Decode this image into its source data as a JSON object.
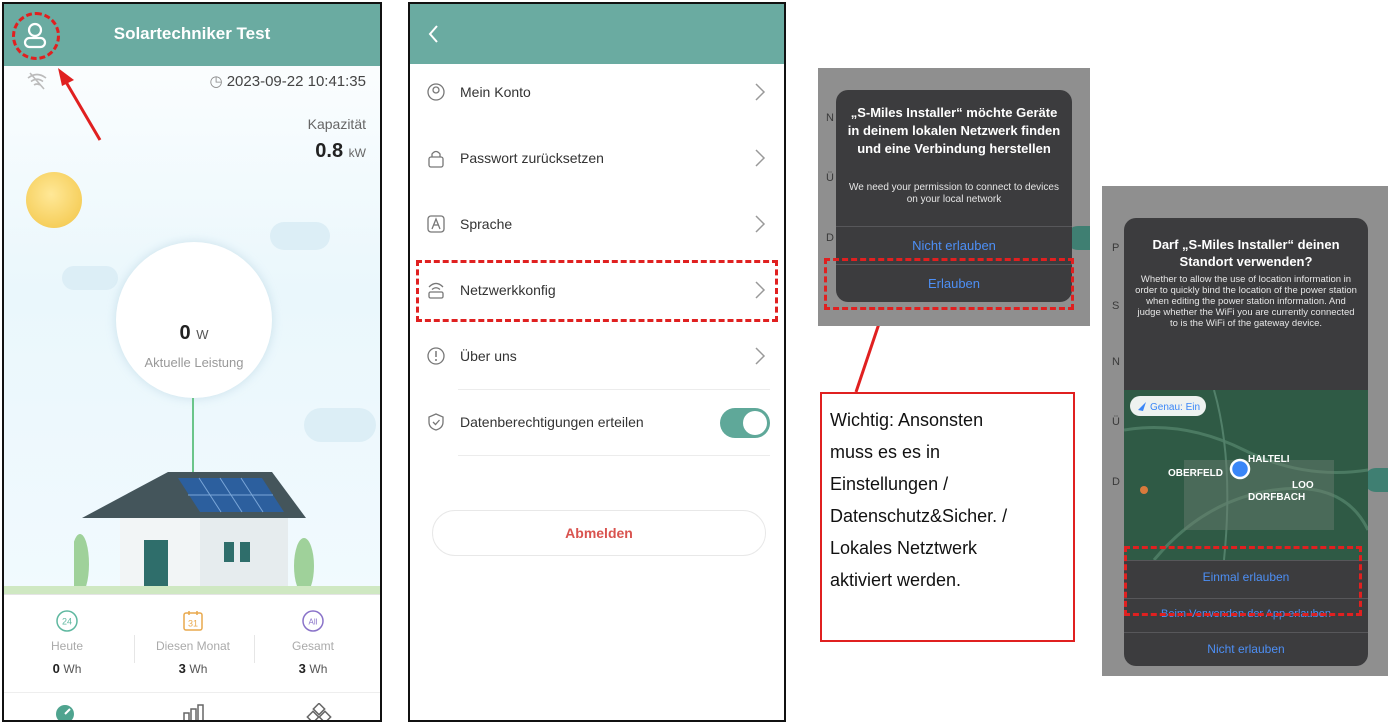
{
  "phone1": {
    "title": "Solartechniker Test",
    "datetime": "2023-09-22 10:41:35",
    "capacity_label": "Kapazität",
    "capacity_value": "0.8",
    "capacity_unit": "kW",
    "power_value": "0",
    "power_unit": "W",
    "power_label": "Aktuelle Leistung",
    "stats": [
      {
        "icon_text": "24",
        "label": "Heute",
        "value": "0",
        "unit": "Wh"
      },
      {
        "icon_text": "31",
        "label": "Diesen Monat",
        "value": "3",
        "unit": "Wh"
      },
      {
        "icon_text": "All",
        "label": "Gesamt",
        "value": "3",
        "unit": "Wh"
      }
    ],
    "icons": [
      "user-icon",
      "wifi-off-icon",
      "clock-icon",
      "gauge-icon",
      "bar-chart-icon",
      "devices-icon"
    ]
  },
  "phone2": {
    "menu": [
      {
        "label": "Mein Konto",
        "icon": "account-icon"
      },
      {
        "label": "Passwort zurücksetzen",
        "icon": "lock-icon"
      },
      {
        "label": "Sprache",
        "icon": "language-icon"
      },
      {
        "label": "Netzwerkkonfig",
        "icon": "router-icon"
      },
      {
        "label": "Über uns",
        "icon": "info-icon"
      },
      {
        "label": "Datenberechtigungen erteilen",
        "icon": "shield-icon"
      }
    ],
    "logout_label": "Abmelden"
  },
  "dialog_network": {
    "title": "„S-Miles Installer“ möchte Geräte in deinem lokalen Netzwerk finden und eine Verbindung herstellen",
    "message": "We need your permission to connect to devices on your local network",
    "deny_label": "Nicht erlauben",
    "allow_label": "Erlauben"
  },
  "note": {
    "lines": [
      "Wichtig: Ansonsten",
      "muss es es in",
      "Einstellungen /",
      "Datenschutz&Sicher. /",
      "Lokales Netztwerk",
      "aktiviert werden."
    ]
  },
  "dialog_location": {
    "title": "Darf „S-Miles Installer“ deinen Standort verwenden?",
    "message": "Whether to allow the use of location information in order to quickly bind the location of the power station when editing the power station information. And judge whether the WiFi you are currently connected to is the WiFi of the gateway device.",
    "precise_label": "Genau: Ein",
    "map_labels": [
      "HALTELI",
      "OBERFELD",
      "LOO",
      "DORFBACH"
    ],
    "allow_once_label": "Einmal erlauben",
    "allow_while_using_label": "Beim Verwenden der App erlauben",
    "deny_label": "Nicht erlauben"
  },
  "colors": {
    "header_teal": "#6aaba1",
    "toggle_green": "#5fa899",
    "annotation_red": "#e02020",
    "ios_blue": "#4d8ff5",
    "logout_red": "#d9534f"
  }
}
